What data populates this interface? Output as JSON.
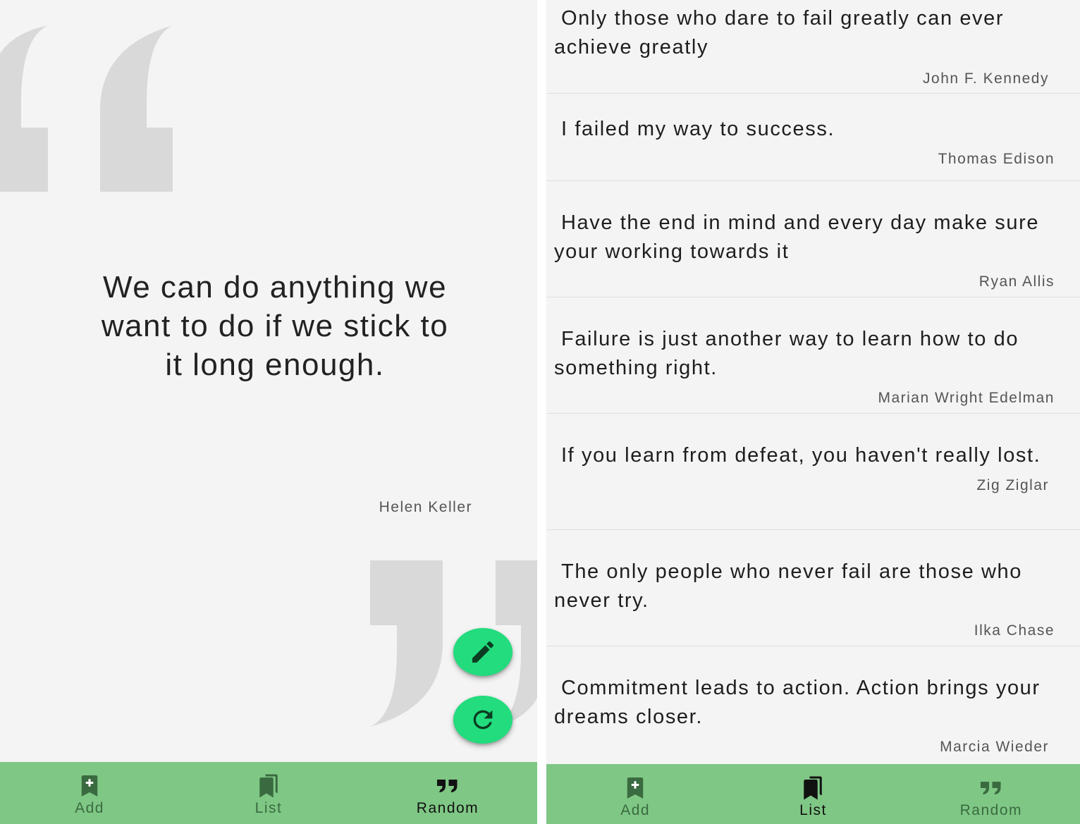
{
  "random_screen": {
    "quote": "We can do anything we want to do if we stick to it long enough.",
    "author": "Helen Keller",
    "open_quote_icon": "open-quote-mark",
    "close_quote_icon": "close-quote-mark",
    "edit_fab_icon": "pencil-icon",
    "refresh_fab_icon": "refresh-icon",
    "fab_color": "#22dc7d"
  },
  "list_screen": {
    "quotes": [
      {
        "text": "Only those who dare to fail greatly can ever achieve greatly",
        "author": "John F. Kennedy"
      },
      {
        "text": "I failed my way to success.",
        "author": "Thomas Edison"
      },
      {
        "text": "Have the end in mind and every day make sure your working towards it",
        "author": "Ryan Allis"
      },
      {
        "text": "Failure is just another way to learn how to do something right.",
        "author": "Marian Wright Edelman"
      },
      {
        "text": "If you learn from defeat, you haven't really lost.",
        "author": "Zig Ziglar"
      },
      {
        "text": "The only people who never fail are those who never try.",
        "author": "Ilka Chase"
      },
      {
        "text": "Commitment leads to action. Action brings your dreams closer.",
        "author": "Marcia Wieder"
      }
    ]
  },
  "nav": {
    "add_label": "Add",
    "list_label": "List",
    "random_label": "Random",
    "bar_color": "#7fc785",
    "inactive_color": "#3a6b40",
    "active_color": "#111111"
  }
}
